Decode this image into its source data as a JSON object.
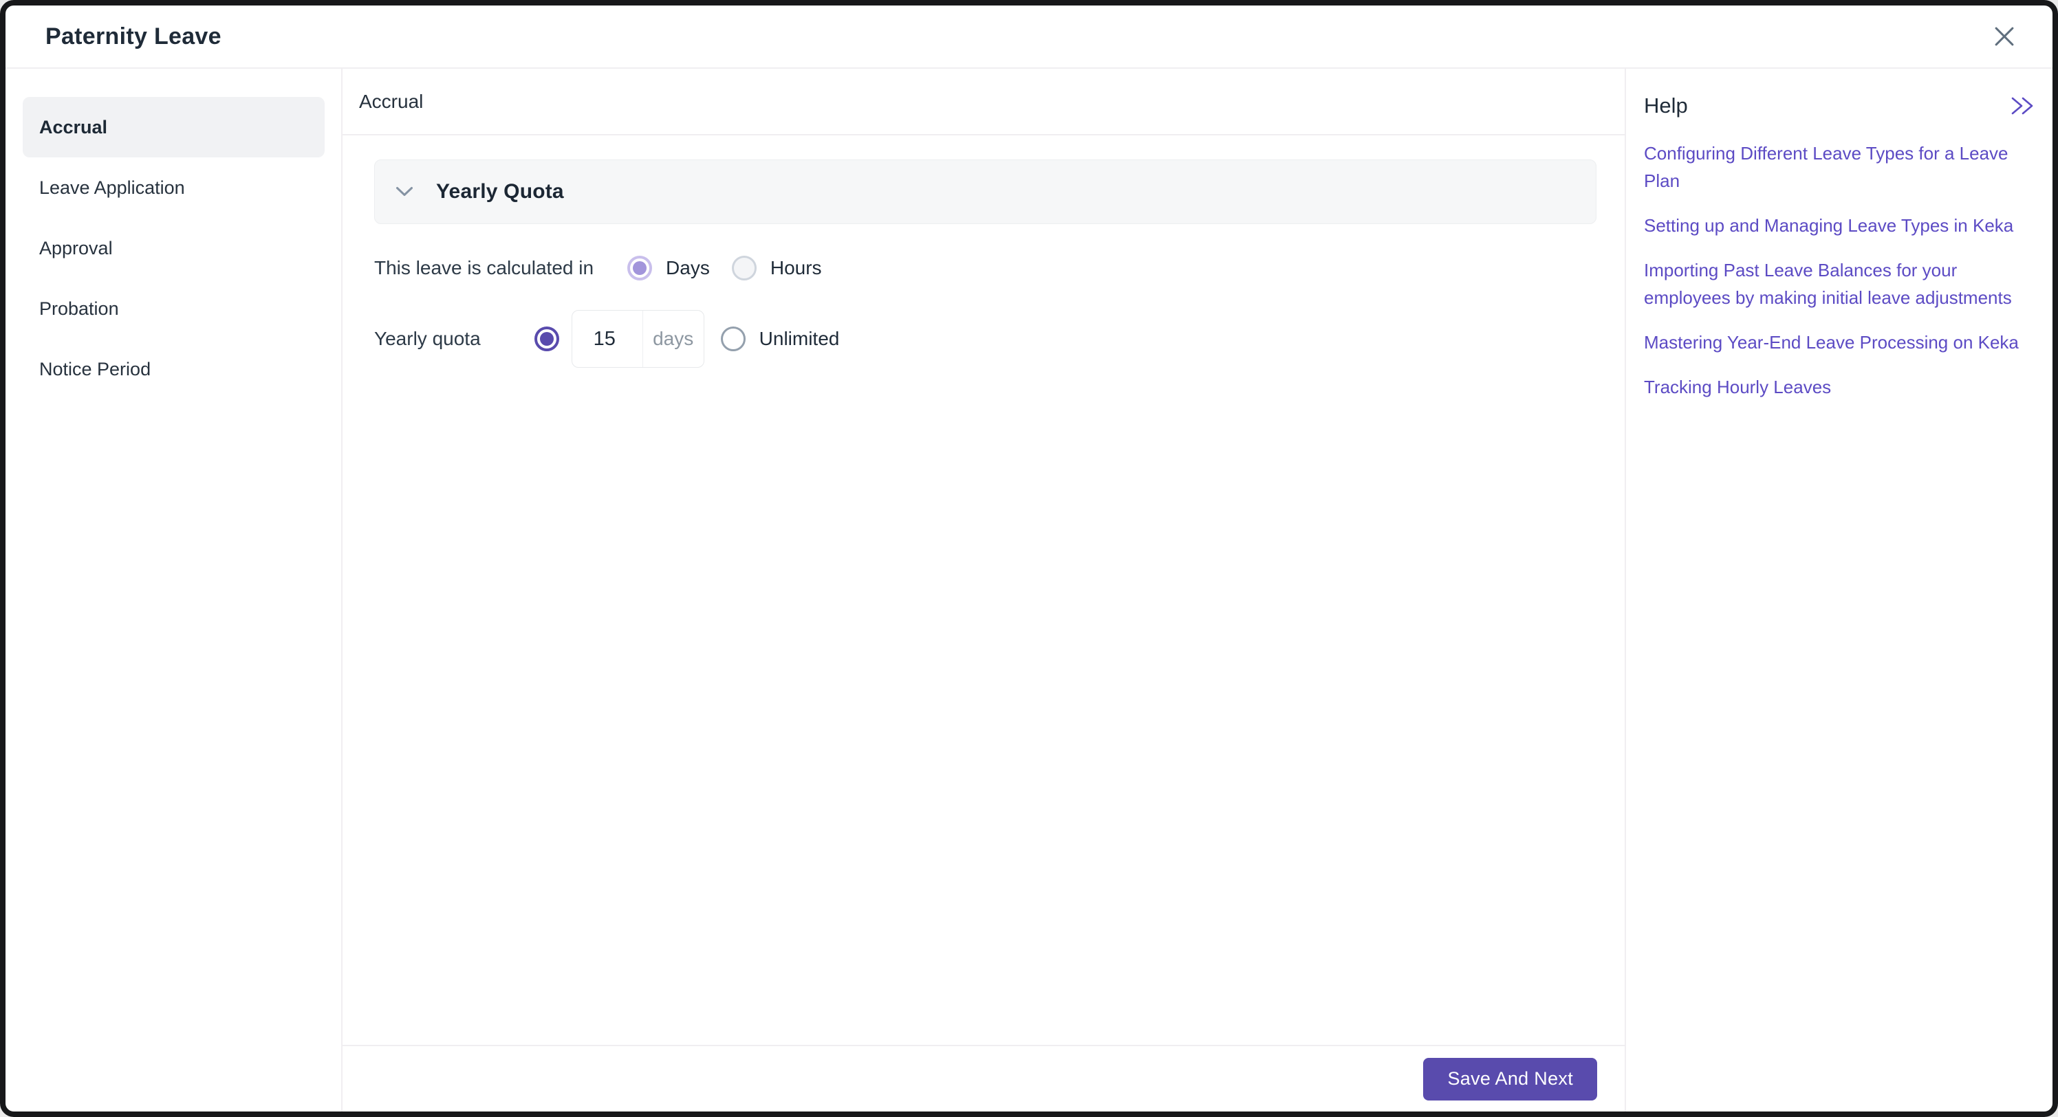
{
  "colors": {
    "frame": "#17181a",
    "accent": "#594bad",
    "link": "#5c4bc4",
    "text-dark": "#1f2b38",
    "text-body": "#2d3a47",
    "text-muted": "#8d97a1",
    "divider": "#f0eef1",
    "panel-bg": "#f6f7f8",
    "panel-border": "#eceef0",
    "active-bg": "#f1f2f4",
    "radio-soft-ring": "#c9bfec",
    "radio-soft-dot": "#a295db",
    "radio-gray-ring": "#cfd5dd",
    "radio-gray-fill": "#f4f5f7",
    "radio-slate-ring": "#94a0ad"
  },
  "window": {
    "title": "Paternity Leave",
    "close_icon": "close-icon"
  },
  "sidebar": {
    "items": [
      {
        "label": "Accrual",
        "active": true
      },
      {
        "label": "Leave Application",
        "active": false
      },
      {
        "label": "Approval",
        "active": false
      },
      {
        "label": "Probation",
        "active": false
      },
      {
        "label": "Notice Period",
        "active": false
      }
    ]
  },
  "main": {
    "heading": "Accrual",
    "quota_section": {
      "title": "Yearly Quota",
      "collapse_icon": "chevron-down-icon",
      "expanded": true
    },
    "calc_row": {
      "label": "This leave is calculated in",
      "options": [
        {
          "label": "Days",
          "selected": true
        },
        {
          "label": "Hours",
          "selected": false
        }
      ]
    },
    "quota_row": {
      "label": "Yearly quota",
      "quota_radio_selected": true,
      "value": "15",
      "unit": "days",
      "unlimited_label": "Unlimited",
      "unlimited_selected": false
    },
    "footer": {
      "save_label": "Save And Next"
    }
  },
  "help": {
    "title": "Help",
    "expand_icon": "double-chevron-right-icon",
    "links": [
      "Configuring Different Leave Types for a Leave Plan",
      "Setting up and Managing Leave Types in Keka",
      "Importing Past Leave Balances for your employees by making initial leave adjustments",
      "Mastering Year-End Leave Processing on Keka",
      "Tracking Hourly Leaves"
    ]
  }
}
